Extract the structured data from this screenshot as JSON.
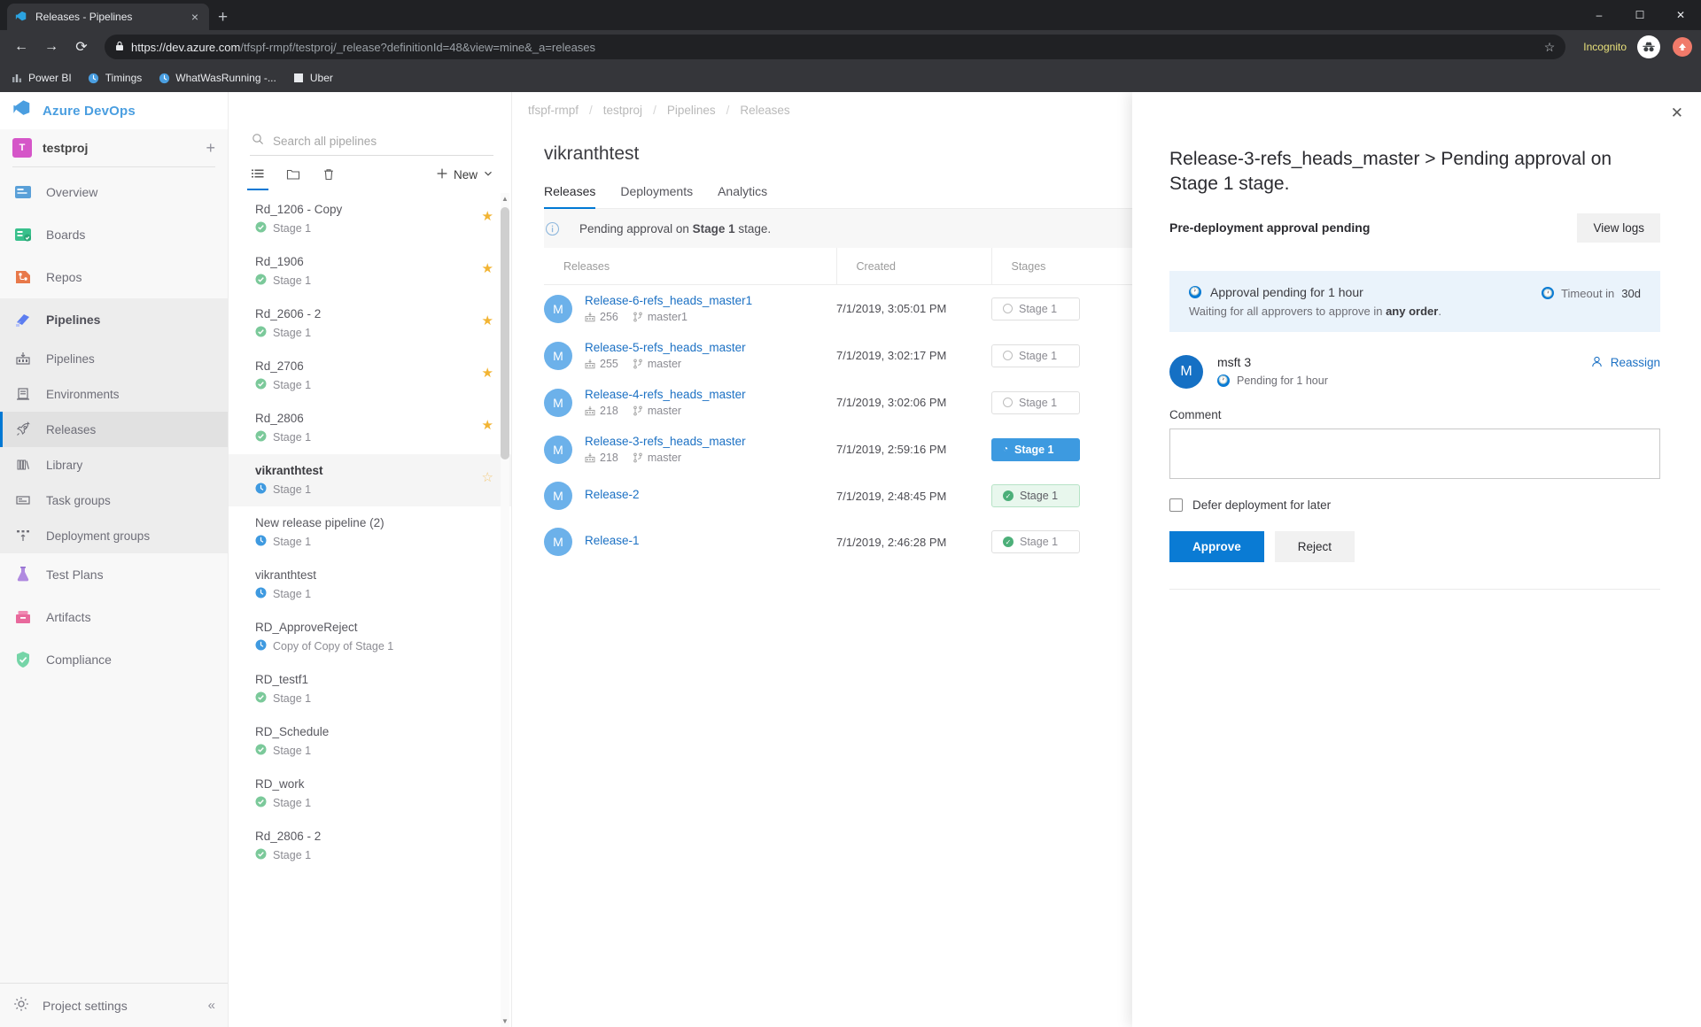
{
  "browser": {
    "tab_title": "Releases - Pipelines",
    "tab_close": "×",
    "new_tab": "+",
    "win_min": "–",
    "win_max": "☐",
    "win_close": "✕",
    "back": "←",
    "forward": "→",
    "reload": "⟳",
    "lock": "🔒",
    "url_prefix": "https://dev.azure.com",
    "url_rest": "/tfspf-rmpf/testproj/_release?definitionId=48&view=mine&_a=releases",
    "star": "☆",
    "incognito_label": "Incognito",
    "bookmarks": [
      {
        "label": "Power BI",
        "icon": "chart-icon"
      },
      {
        "label": "Timings",
        "icon": "clock-icon"
      },
      {
        "label": "WhatWasRunning -...",
        "icon": "clock-icon"
      },
      {
        "label": "Uber",
        "icon": "square-icon"
      }
    ]
  },
  "leftnav": {
    "brand": "Azure DevOps",
    "project_initial": "T",
    "project_name": "testproj",
    "add_label": "+",
    "items": [
      {
        "label": "Overview",
        "icon": "overview-icon"
      },
      {
        "label": "Boards",
        "icon": "boards-icon"
      },
      {
        "label": "Repos",
        "icon": "repos-icon"
      },
      {
        "label": "Pipelines",
        "icon": "pipelines-icon"
      }
    ],
    "sub_items": [
      {
        "label": "Pipelines",
        "icon": "pipelines-sub-icon"
      },
      {
        "label": "Environments",
        "icon": "environments-icon"
      },
      {
        "label": "Releases",
        "icon": "releases-icon"
      },
      {
        "label": "Library",
        "icon": "library-icon"
      },
      {
        "label": "Task groups",
        "icon": "task-groups-icon"
      },
      {
        "label": "Deployment groups",
        "icon": "deployment-groups-icon"
      }
    ],
    "tail_items": [
      {
        "label": "Test Plans",
        "icon": "test-plans-icon"
      },
      {
        "label": "Artifacts",
        "icon": "artifacts-icon"
      },
      {
        "label": "Compliance",
        "icon": "compliance-icon"
      }
    ],
    "project_settings": "Project settings",
    "collapse": "«"
  },
  "pipelines_pane": {
    "search_placeholder": "Search all pipelines",
    "new_label": "New",
    "tools": [
      {
        "name": "list-view-icon"
      },
      {
        "name": "folder-icon"
      },
      {
        "name": "trash-icon"
      }
    ],
    "items": [
      {
        "name": "Rd_1206 - Copy",
        "stage": "Stage 1",
        "status": "ok",
        "favorite": true
      },
      {
        "name": "Rd_1906",
        "stage": "Stage 1",
        "status": "ok",
        "favorite": true
      },
      {
        "name": "Rd_2606 - 2",
        "stage": "Stage 1",
        "status": "ok",
        "favorite": true
      },
      {
        "name": "Rd_2706",
        "stage": "Stage 1",
        "status": "ok",
        "favorite": true
      },
      {
        "name": "Rd_2806",
        "stage": "Stage 1",
        "status": "ok",
        "favorite": true
      },
      {
        "name": "vikranthtest",
        "stage": "Stage 1",
        "status": "pending",
        "favorite": false,
        "selected": true
      },
      {
        "name": "New release pipeline (2)",
        "stage": "Stage 1",
        "status": "pending",
        "favorite": null
      },
      {
        "name": "vikranthtest",
        "stage": "Stage 1",
        "status": "pending",
        "favorite": null
      },
      {
        "name": "RD_ApproveReject",
        "stage": "Copy of Copy of Stage 1",
        "status": "pending",
        "favorite": null
      },
      {
        "name": "RD_testf1",
        "stage": "Stage 1",
        "status": "ok",
        "favorite": null
      },
      {
        "name": "RD_Schedule",
        "stage": "Stage 1",
        "status": "ok",
        "favorite": null
      },
      {
        "name": "RD_work",
        "stage": "Stage 1",
        "status": "ok",
        "favorite": null
      },
      {
        "name": "Rd_2806 - 2",
        "stage": "Stage 1",
        "status": "ok",
        "favorite": null
      }
    ]
  },
  "main": {
    "breadcrumb": [
      "tfspf-rmpf",
      "testproj",
      "Pipelines",
      "Releases"
    ],
    "breadcrumb_sep": "/",
    "page_title": "vikranthtest",
    "tabs": [
      {
        "label": "Releases",
        "active": true
      },
      {
        "label": "Deployments",
        "active": false
      },
      {
        "label": "Analytics",
        "active": false
      }
    ],
    "info_icon": "info-icon",
    "info_text_pre": "Pending approval on ",
    "info_text_bold": "Stage 1",
    "info_text_post": " stage.",
    "columns": [
      "Releases",
      "Created",
      "Stages"
    ],
    "rows": [
      {
        "avatar": "M",
        "name": "Release-6-refs_heads_master1",
        "build": "256",
        "branch": "master1",
        "created": "7/1/2019, 3:05:01 PM",
        "stage_label": "Stage 1",
        "stage_state": "notstarted"
      },
      {
        "avatar": "M",
        "name": "Release-5-refs_heads_master",
        "build": "255",
        "branch": "master",
        "created": "7/1/2019, 3:02:17 PM",
        "stage_label": "Stage 1",
        "stage_state": "notstarted"
      },
      {
        "avatar": "M",
        "name": "Release-4-refs_heads_master",
        "build": "218",
        "branch": "master",
        "created": "7/1/2019, 3:02:06 PM",
        "stage_label": "Stage 1",
        "stage_state": "notstarted"
      },
      {
        "avatar": "M",
        "name": "Release-3-refs_heads_master",
        "build": "218",
        "branch": "master",
        "created": "7/1/2019, 2:59:16 PM",
        "stage_label": "Stage 1",
        "stage_state": "pending"
      },
      {
        "avatar": "M",
        "name": "Release-2",
        "build": "",
        "branch": "",
        "created": "7/1/2019, 2:48:45 PM",
        "stage_label": "Stage 1",
        "stage_state": "succeeded"
      },
      {
        "avatar": "M",
        "name": "Release-1",
        "build": "",
        "branch": "",
        "created": "7/1/2019, 2:46:28 PM",
        "stage_label": "Stage 1",
        "stage_state": "succeeded-outline"
      }
    ]
  },
  "panel": {
    "close": "✕",
    "title": "Release-3-refs_heads_master > Pending approval on Stage 1 stage.",
    "subtitle": "Pre-deployment approval pending",
    "view_logs": "View logs",
    "banner_title": "Approval pending for 1 hour",
    "banner_sub_pre": "Waiting for all approvers to approve in ",
    "banner_sub_bold": "any order",
    "banner_sub_post": ".",
    "timeout_pre": "Timeout in ",
    "timeout_value": "30d",
    "approver_avatar": "M",
    "approver_name": "msft 3",
    "approver_pending": "Pending for 1 hour",
    "reassign": "Reassign",
    "comment_label": "Comment",
    "comment_value": "",
    "defer_label": "Defer deployment for later",
    "approve": "Approve",
    "reject": "Reject"
  }
}
